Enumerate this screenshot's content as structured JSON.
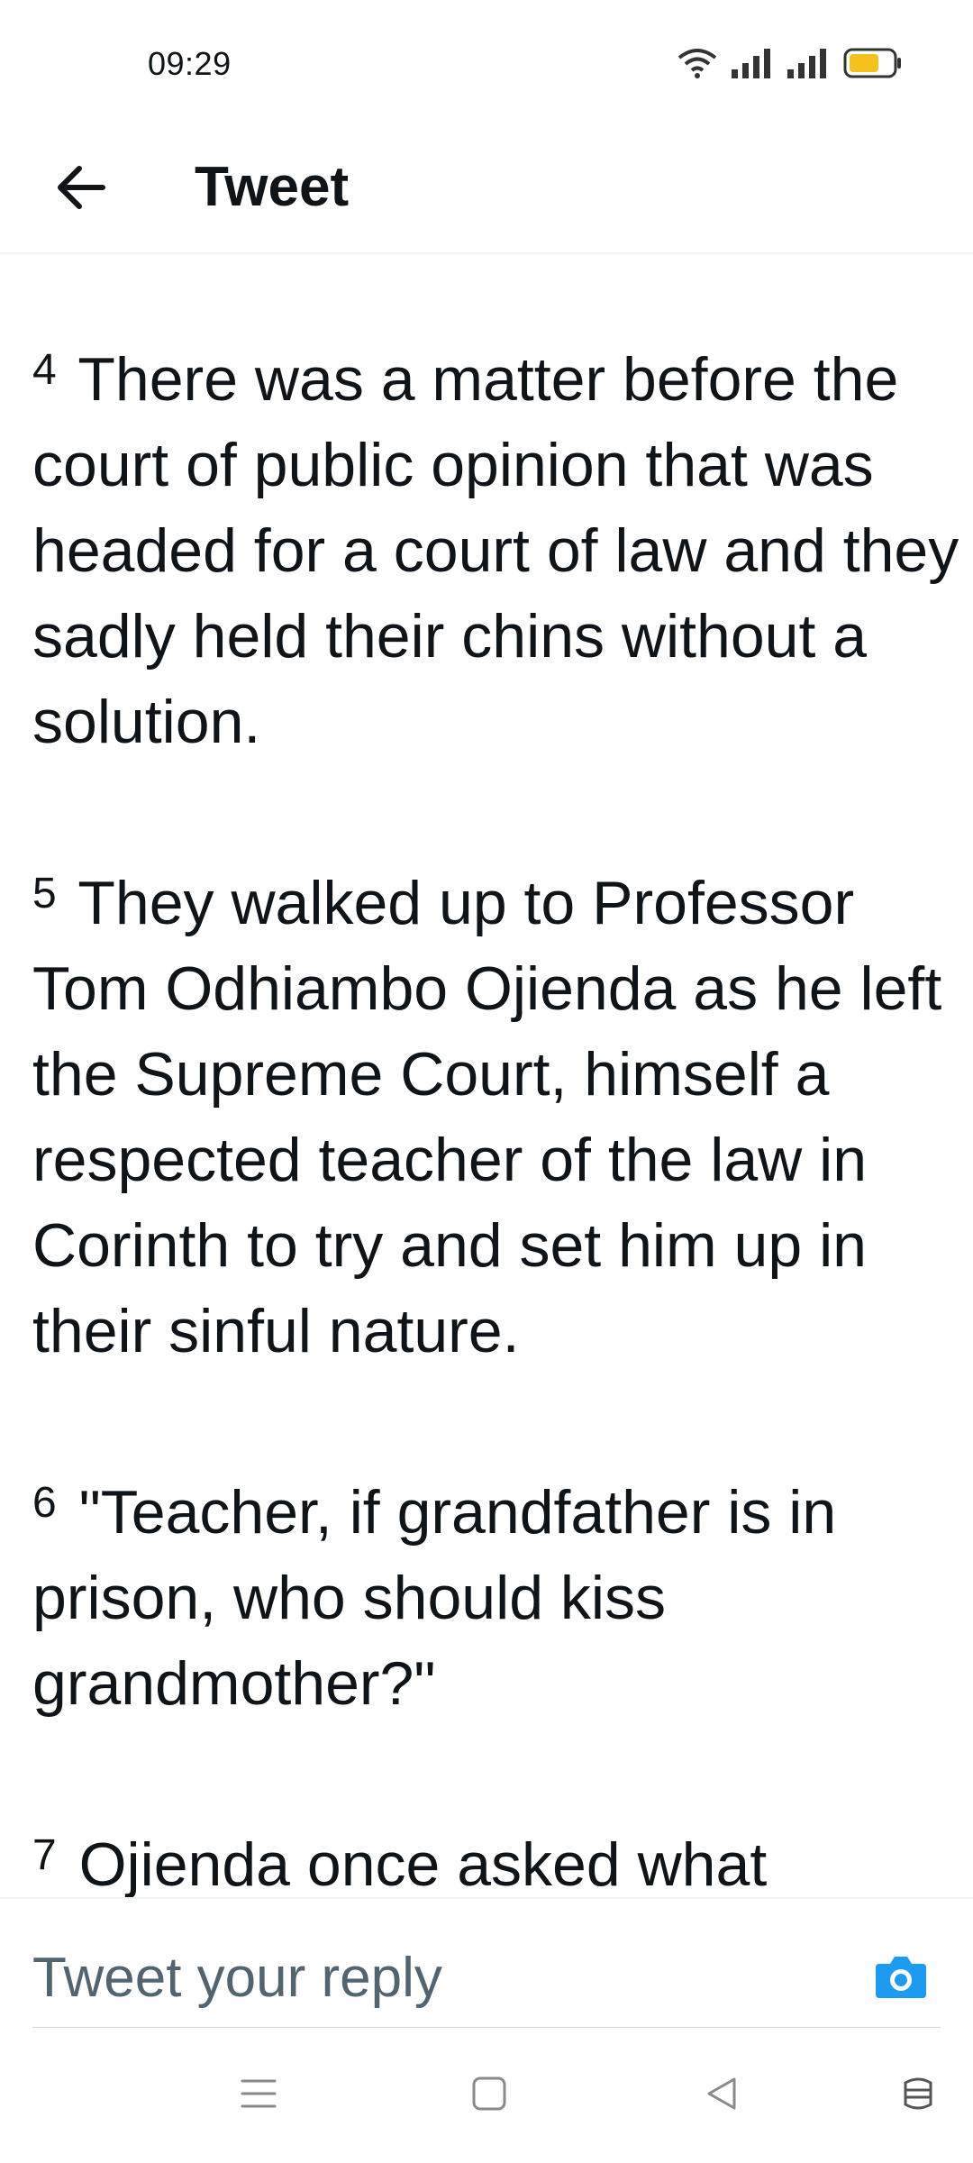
{
  "status_bar": {
    "time": "09:29",
    "icons": [
      "wifi-icon",
      "signal-icon",
      "signal-icon",
      "battery-icon"
    ],
    "battery_color": "#f5c11b"
  },
  "header": {
    "back_icon": "arrow-left-icon",
    "title": "Tweet"
  },
  "tweet": {
    "paragraphs": [
      {
        "num": "4",
        "text": "There was a matter before the court of public opinion that was headed for a court of law and they sadly held their chins without a solution."
      },
      {
        "num": "5",
        "text": "They walked up to Professor Tom Odhiambo Ojienda as he left the Supreme Court, himself a respected teacher of the law in Corinth to try and set him up in their sinful nature."
      },
      {
        "num": "6",
        "text": "\"Teacher, if grandfather is in prison, who should kiss grandmother?\""
      },
      {
        "num": "7",
        "text": "Ojienda once asked what"
      }
    ]
  },
  "reply": {
    "placeholder": "Tweet your reply",
    "camera_icon": "camera-icon",
    "accent_color": "#1d9bf0"
  },
  "nav_bar": {
    "icons": [
      "menu-icon",
      "home-square-icon",
      "back-triangle-icon",
      "assistant-icon"
    ]
  }
}
